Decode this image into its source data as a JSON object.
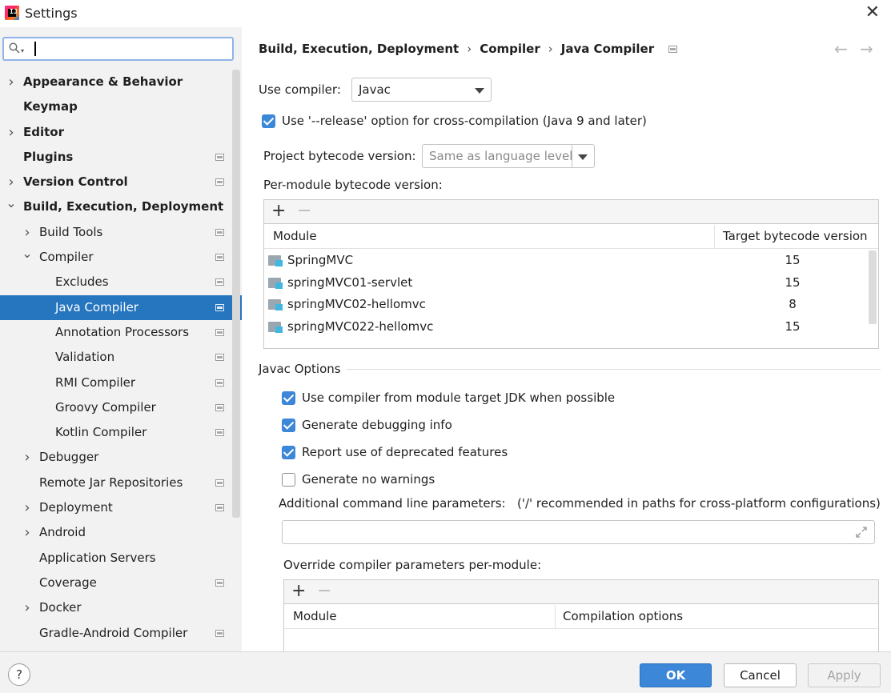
{
  "window": {
    "title": "Settings"
  },
  "search": {
    "placeholder": ""
  },
  "sidebar": {
    "items": [
      {
        "label": "Appearance & Behavior",
        "bold": true,
        "indent": 0,
        "chevron": "right",
        "proj": false
      },
      {
        "label": "Keymap",
        "bold": true,
        "indent": 0,
        "chevron": "",
        "proj": false
      },
      {
        "label": "Editor",
        "bold": true,
        "indent": 0,
        "chevron": "right",
        "proj": false
      },
      {
        "label": "Plugins",
        "bold": true,
        "indent": 0,
        "chevron": "",
        "proj": true
      },
      {
        "label": "Version Control",
        "bold": true,
        "indent": 0,
        "chevron": "right",
        "proj": true
      },
      {
        "label": "Build, Execution, Deployment",
        "bold": true,
        "indent": 0,
        "chevron": "down",
        "proj": false
      },
      {
        "label": "Build Tools",
        "bold": false,
        "indent": 1,
        "chevron": "right",
        "proj": true
      },
      {
        "label": "Compiler",
        "bold": false,
        "indent": 1,
        "chevron": "down",
        "proj": true
      },
      {
        "label": "Excludes",
        "bold": false,
        "indent": 2,
        "chevron": "",
        "proj": true
      },
      {
        "label": "Java Compiler",
        "bold": false,
        "indent": 2,
        "chevron": "",
        "proj": true,
        "selected": true
      },
      {
        "label": "Annotation Processors",
        "bold": false,
        "indent": 2,
        "chevron": "",
        "proj": true
      },
      {
        "label": "Validation",
        "bold": false,
        "indent": 2,
        "chevron": "",
        "proj": true
      },
      {
        "label": "RMI Compiler",
        "bold": false,
        "indent": 2,
        "chevron": "",
        "proj": true
      },
      {
        "label": "Groovy Compiler",
        "bold": false,
        "indent": 2,
        "chevron": "",
        "proj": true
      },
      {
        "label": "Kotlin Compiler",
        "bold": false,
        "indent": 2,
        "chevron": "",
        "proj": true
      },
      {
        "label": "Debugger",
        "bold": false,
        "indent": 1,
        "chevron": "right",
        "proj": false
      },
      {
        "label": "Remote Jar Repositories",
        "bold": false,
        "indent": 1,
        "chevron": "",
        "proj": true
      },
      {
        "label": "Deployment",
        "bold": false,
        "indent": 1,
        "chevron": "right",
        "proj": true
      },
      {
        "label": "Android",
        "bold": false,
        "indent": 1,
        "chevron": "right",
        "proj": false
      },
      {
        "label": "Application Servers",
        "bold": false,
        "indent": 1,
        "chevron": "",
        "proj": false
      },
      {
        "label": "Coverage",
        "bold": false,
        "indent": 1,
        "chevron": "",
        "proj": true
      },
      {
        "label": "Docker",
        "bold": false,
        "indent": 1,
        "chevron": "right",
        "proj": false
      },
      {
        "label": "Gradle-Android Compiler",
        "bold": false,
        "indent": 1,
        "chevron": "",
        "proj": true
      }
    ]
  },
  "breadcrumb": {
    "part1": "Build, Execution, Deployment",
    "part2": "Compiler",
    "part3": "Java Compiler",
    "sep": "›"
  },
  "compiler": {
    "use_compiler_label": "Use compiler:",
    "use_compiler_value": "Javac",
    "release_option_label": "Use '--release' option for cross-compilation (Java 9 and later)",
    "release_option_checked": true,
    "bytecode_label": "Project bytecode version:",
    "bytecode_value": "Same as language level",
    "per_module_label": "Per-module bytecode version:",
    "module_table": {
      "col_module": "Module",
      "col_target": "Target bytecode version",
      "rows": [
        {
          "module": "SpringMVC",
          "version": "15"
        },
        {
          "module": "springMVC01-servlet",
          "version": "15"
        },
        {
          "module": "springMVC02-hellomvc",
          "version": "8"
        },
        {
          "module": "springMVC022-hellomvc",
          "version": "15"
        }
      ]
    }
  },
  "javac": {
    "section_label": "Javac Options",
    "opt_target_jdk": "Use compiler from module target JDK when possible",
    "opt_debug": "Generate debugging info",
    "opt_deprecated": "Report use of deprecated features",
    "opt_no_warnings": "Generate no warnings",
    "additional_params_label": "Additional command line parameters:",
    "additional_params_hint": "('/' recommended in paths for cross-platform configurations)",
    "additional_params_value": "",
    "override_label": "Override compiler parameters per-module:",
    "override_table": {
      "col_module": "Module",
      "col_options": "Compilation options"
    }
  },
  "toolbar": {
    "add": "+",
    "remove": "−"
  },
  "footer": {
    "help": "?",
    "ok": "OK",
    "cancel": "Cancel",
    "apply": "Apply"
  },
  "colors": {
    "accent": "#3c87d8",
    "selection": "#2675bf"
  }
}
